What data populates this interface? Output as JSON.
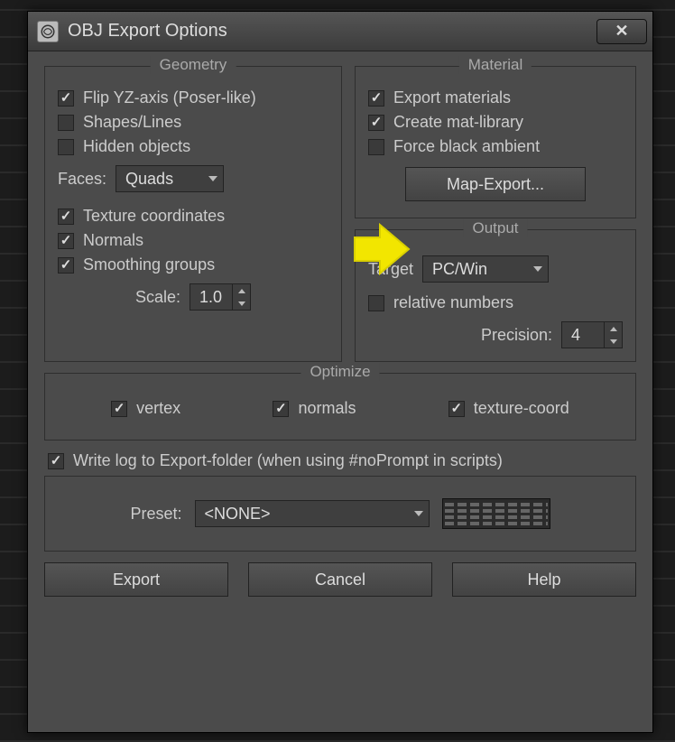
{
  "title": "OBJ Export Options",
  "groups": {
    "geometry": "Geometry",
    "material": "Material",
    "output": "Output",
    "optimize": "Optimize"
  },
  "geometry": {
    "flip_yz": {
      "label": "Flip YZ-axis (Poser-like)",
      "checked": true
    },
    "shapes": {
      "label": "Shapes/Lines",
      "checked": false
    },
    "hidden": {
      "label": "Hidden objects",
      "checked": false
    },
    "faces_label": "Faces:",
    "faces_value": "Quads",
    "texcoord": {
      "label": "Texture coordinates",
      "checked": true
    },
    "normals": {
      "label": "Normals",
      "checked": true
    },
    "smoothing": {
      "label": "Smoothing groups",
      "checked": true
    },
    "scale_label": "Scale:",
    "scale_value": "1.0"
  },
  "material": {
    "export_mat": {
      "label": "Export materials",
      "checked": true
    },
    "create_lib": {
      "label": "Create mat-library",
      "checked": true
    },
    "force_black": {
      "label": "Force black ambient",
      "checked": false
    },
    "map_export_btn": "Map-Export..."
  },
  "output": {
    "target_label": "Target",
    "target_value": "PC/Win",
    "relative": {
      "label": "relative numbers",
      "checked": false
    },
    "precision_label": "Precision:",
    "precision_value": "4"
  },
  "optimize": {
    "vertex": {
      "label": "vertex",
      "checked": true
    },
    "normals": {
      "label": "normals",
      "checked": true
    },
    "texcoord": {
      "label": "texture-coord",
      "checked": true
    }
  },
  "writelog": {
    "label": "Write log to Export-folder (when using #noPrompt in scripts)",
    "checked": true
  },
  "preset": {
    "label": "Preset:",
    "value": "<NONE>"
  },
  "buttons": {
    "export": "Export",
    "cancel": "Cancel",
    "help": "Help"
  }
}
